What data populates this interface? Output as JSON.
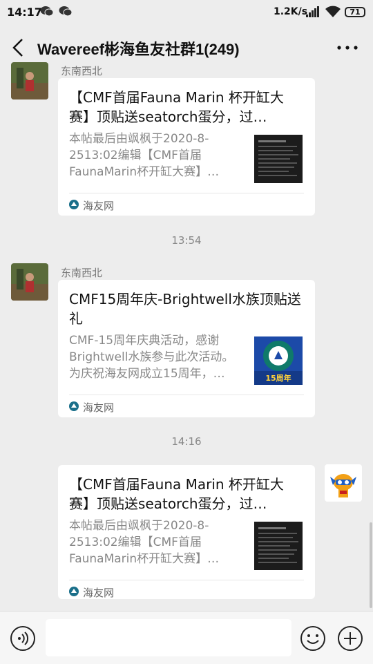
{
  "status_bar": {
    "time": "14:17",
    "net_speed": "1.2K/s",
    "battery": "71"
  },
  "header": {
    "title": "Wavereef彬海鱼友社群1(249)"
  },
  "messages": [
    {
      "sender": "东南西北",
      "card": {
        "title": "【CMF首届Fauna Marin 杯开缸大赛】顶贴送seatorch蛋分，过…",
        "description": "本帖最后由飒枫于2020-8-2513:02编辑【CMF首届FaunaMarin杯开缸大赛】…",
        "source": "海友网"
      }
    },
    {
      "timestamp": "13:54",
      "sender": "东南西北",
      "card": {
        "title": "CMF15周年庆-Brightwell水族顶贴送礼",
        "description": "CMF-15周年庆典活动，感谢Brightwell水族参与此次活动。为庆祝海友网成立15周年，…",
        "source": "海友网",
        "thumb_text": "15周年"
      }
    },
    {
      "timestamp": "14:16",
      "card": {
        "title": "【CMF首届Fauna Marin 杯开缸大赛】顶贴送seatorch蛋分，过…",
        "description": "本帖最后由飒枫于2020-8-2513:02编辑【CMF首届FaunaMarin杯开缸大赛】…",
        "source": "海友网"
      }
    }
  ],
  "input": {
    "value": ""
  },
  "colors": {
    "background": "#ededed",
    "card": "#ffffff",
    "muted_text": "#888888"
  }
}
